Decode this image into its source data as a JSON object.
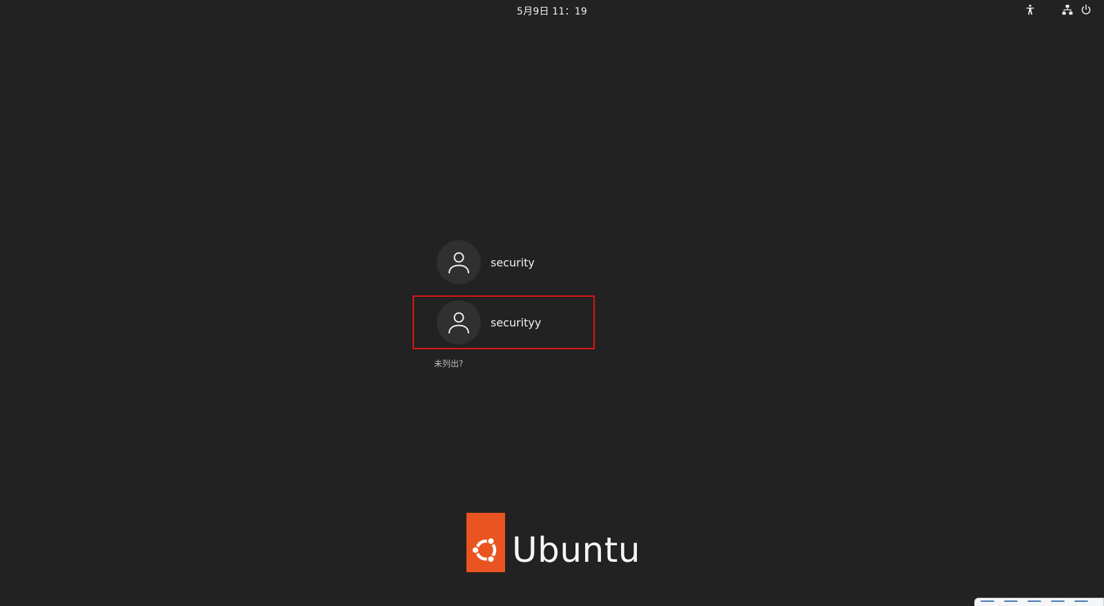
{
  "topbar": {
    "clock": "5月9日  11：19",
    "icons": [
      "accessibility-icon",
      "network-icon",
      "power-icon"
    ]
  },
  "users": [
    {
      "name": "security",
      "avatar_icon": "user-icon",
      "selected": false
    },
    {
      "name": "securityy",
      "avatar_icon": "user-icon",
      "selected": true
    }
  ],
  "not_listed_label": "未列出?",
  "branding": {
    "logo_text": "Ubuntu",
    "logo_icon": "ubuntu-circle-of-friends-icon",
    "accent_color": "#e95420"
  },
  "colors": {
    "background": "#222222",
    "selection_outline": "#e01414"
  }
}
